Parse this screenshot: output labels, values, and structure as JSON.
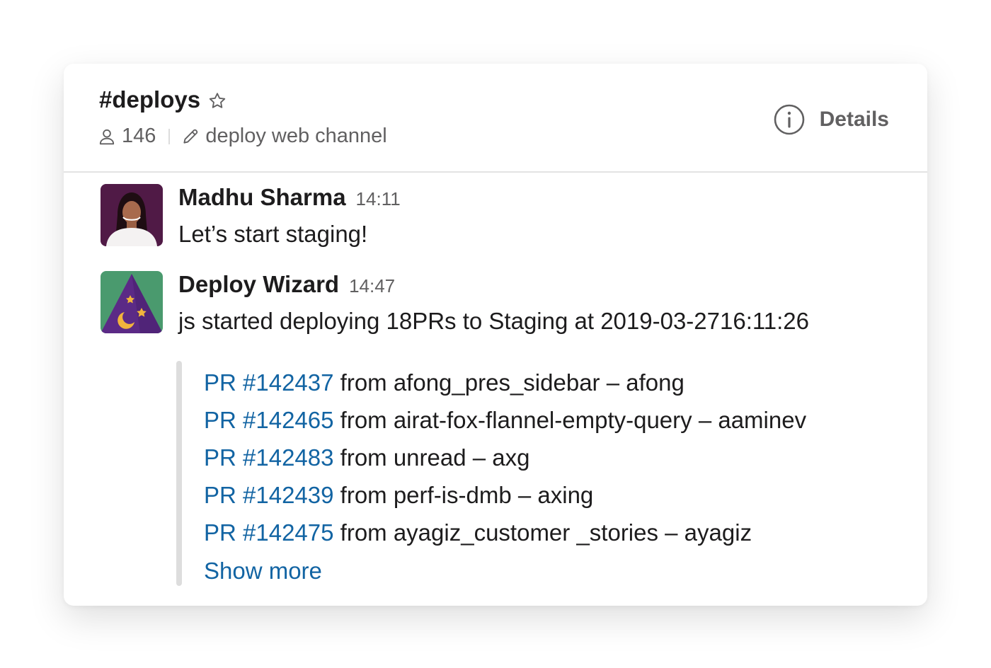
{
  "channel": {
    "name": "#deploys",
    "member_count": "146",
    "topic": "deploy web channel",
    "details_label": "Details"
  },
  "messages": [
    {
      "sender": "Madhu Sharma",
      "time": "14:11",
      "text": "Let’s start staging!"
    },
    {
      "sender": "Deploy Wizard",
      "time": "14:47",
      "text": "js started deploying 18PRs to Staging at 2019-03-2716:11:26",
      "attachment": {
        "prs": [
          {
            "link": "PR #142437",
            "rest": "from afong_pres_sidebar – afong"
          },
          {
            "link": "PR #142465",
            "rest": "from airat-fox-flannel-empty-query – aaminev"
          },
          {
            "link": "PR #142483",
            "rest": "from unread – axg"
          },
          {
            "link": "PR #142439",
            "rest": "from perf-is-dmb – axing"
          },
          {
            "link": "PR #142475",
            "rest": "from ayagiz_customer _stories – ayagiz"
          }
        ],
        "show_more": "Show more"
      }
    }
  ],
  "colors": {
    "link": "#1264a3",
    "text": "#1d1c1d",
    "muted": "#616061",
    "wizard_bg": "#4a9a6e",
    "wizard_hat": "#5b2a86"
  }
}
